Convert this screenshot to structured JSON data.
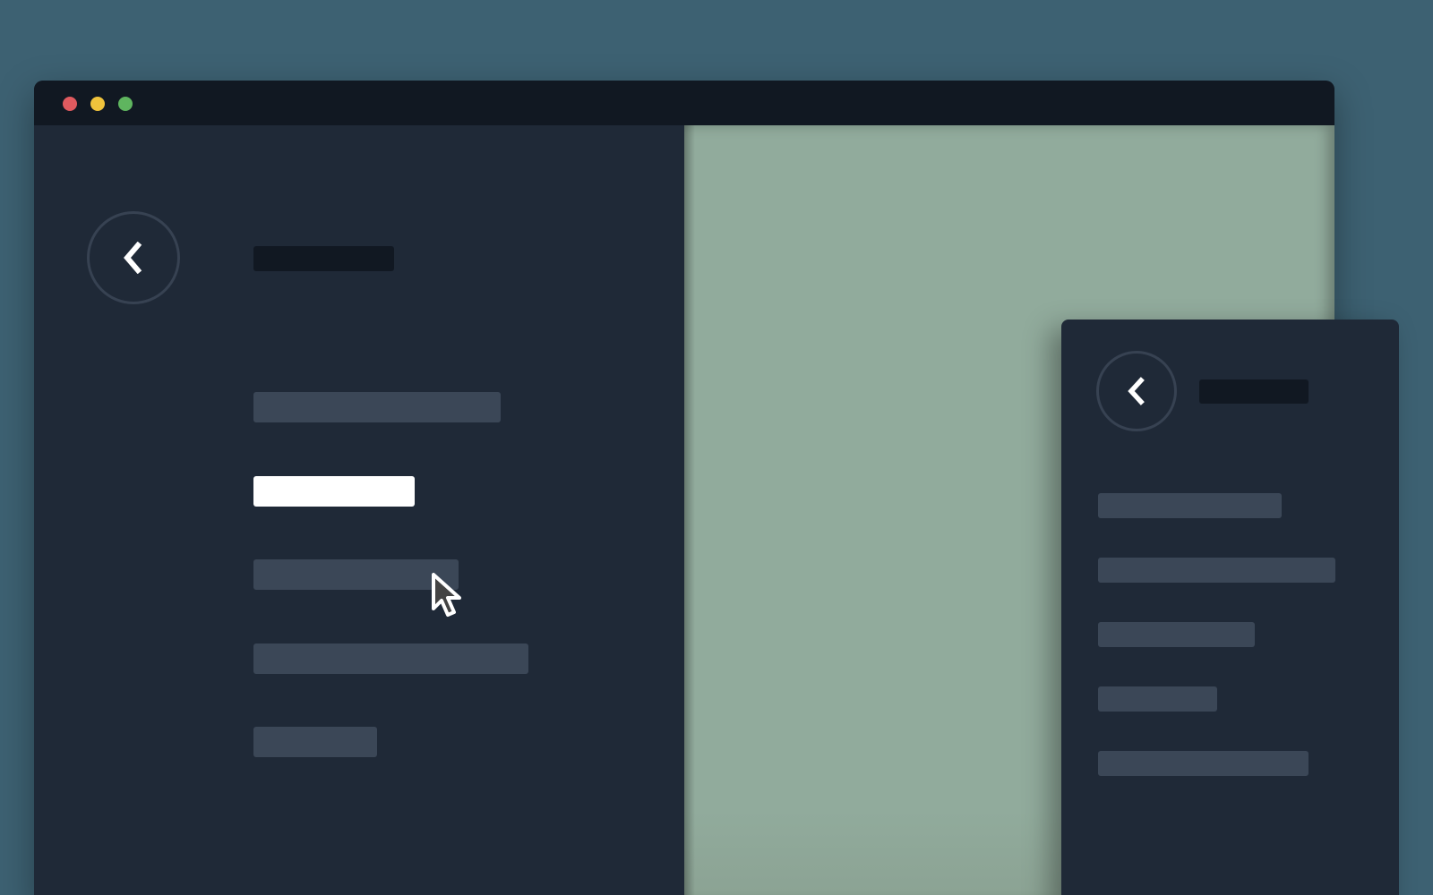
{
  "window": {
    "controls": [
      {
        "name": "close",
        "color": "#e05a5f"
      },
      {
        "name": "minimize",
        "color": "#f0c33c"
      },
      {
        "name": "maximize",
        "color": "#5fb55f"
      }
    ]
  },
  "main_panel": {
    "back_icon": "chevron-left-icon",
    "title": "",
    "menu_items": [
      {
        "label": "",
        "active": false
      },
      {
        "label": "",
        "active": true
      },
      {
        "label": "",
        "active": false
      },
      {
        "label": "",
        "active": false
      },
      {
        "label": "",
        "active": false
      }
    ]
  },
  "popup_panel": {
    "back_icon": "chevron-left-icon",
    "title": "",
    "menu_items": [
      {
        "label": ""
      },
      {
        "label": ""
      },
      {
        "label": ""
      },
      {
        "label": ""
      },
      {
        "label": ""
      }
    ]
  },
  "colors": {
    "desktop": "#3d6172",
    "panel": "#1f2937",
    "titlebar": "#111822",
    "item": "#3b4757",
    "active_item": "#ffffff",
    "content": "#91ab9c"
  }
}
